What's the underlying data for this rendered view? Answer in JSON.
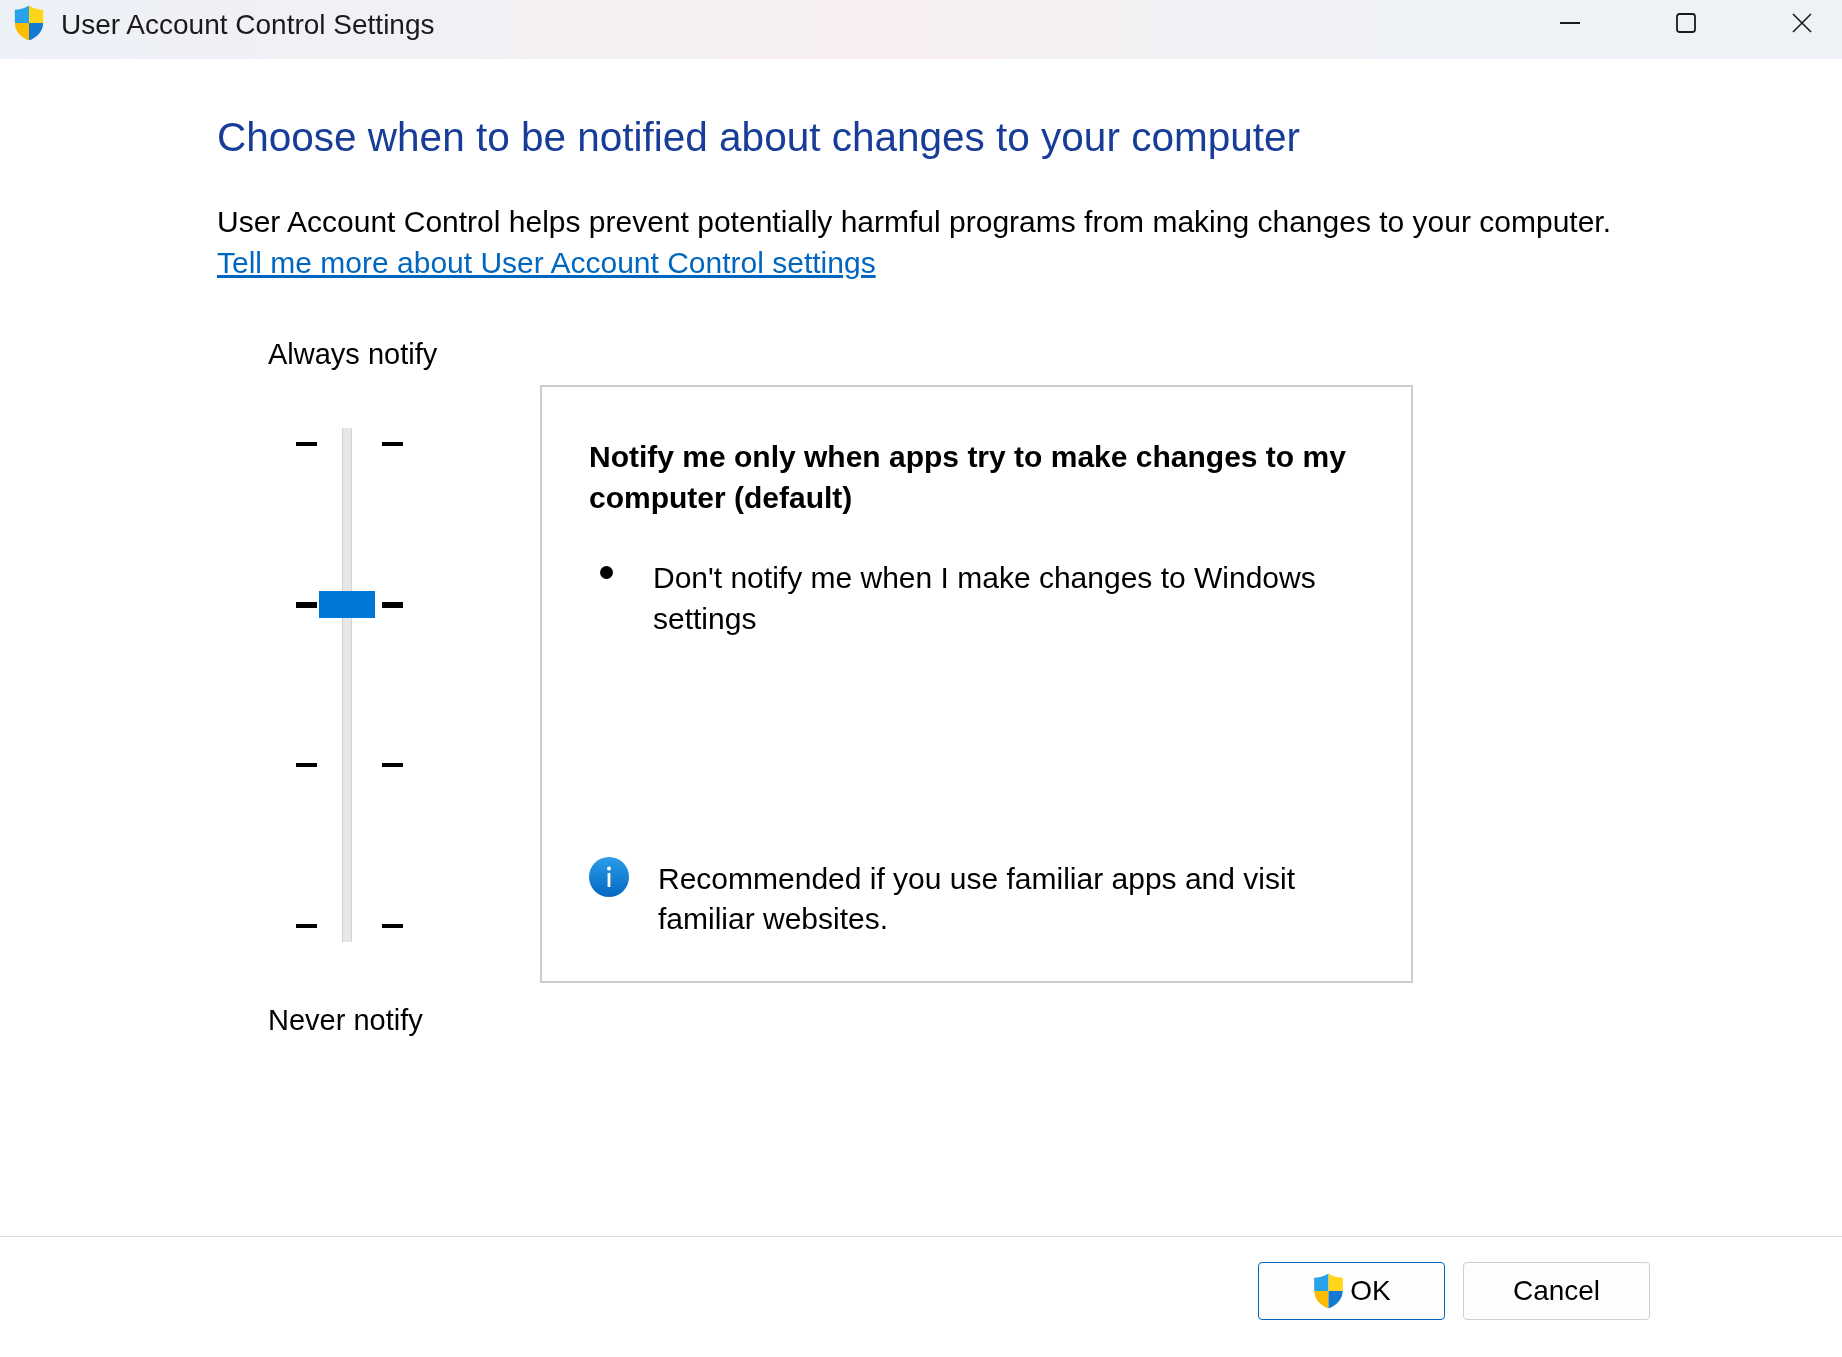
{
  "window": {
    "title": "User Account Control Settings"
  },
  "heading": "Choose when to be notified about changes to your computer",
  "description": "User Account Control helps prevent potentially harmful programs from making changes to your computer.",
  "link": "Tell me more about User Account Control settings",
  "slider": {
    "top_label": "Always notify",
    "bottom_label": "Never notify",
    "level": 0.67
  },
  "details": {
    "title": "Notify me only when apps try to make changes to my computer (default)",
    "bullets": [
      "Don't notify me when I make changes to Windows settings"
    ],
    "note": "Recommended if you use familiar apps and visit familiar websites."
  },
  "buttons": [
    {
      "label": "OK",
      "kind": "elevated",
      "default": true
    },
    {
      "label": "Cancel",
      "kind": "plain",
      "default": false
    }
  ]
}
